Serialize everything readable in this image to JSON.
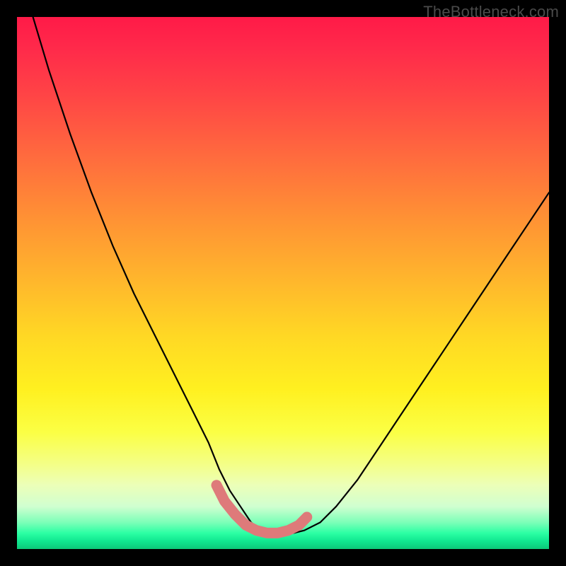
{
  "watermark": "TheBottleneck.com",
  "chart_data": {
    "type": "line",
    "title": "",
    "xlabel": "",
    "ylabel": "",
    "xlim": [
      0,
      100
    ],
    "ylim": [
      0,
      100
    ],
    "series": [
      {
        "name": "black-curve",
        "x": [
          3,
          6,
          10,
          14,
          18,
          22,
          26,
          30,
          33,
          36,
          38,
          40,
          42,
          44,
          46,
          48,
          50,
          52,
          54,
          57,
          60,
          64,
          68,
          72,
          76,
          80,
          84,
          88,
          92,
          96,
          100
        ],
        "values": [
          100,
          90,
          78,
          67,
          57,
          48,
          40,
          32,
          26,
          20,
          15,
          11,
          8,
          5,
          3.5,
          3,
          3,
          3,
          3.5,
          5,
          8,
          13,
          19,
          25,
          31,
          37,
          43,
          49,
          55,
          61,
          67
        ]
      },
      {
        "name": "pink-highlight",
        "x": [
          37.5,
          39,
          41,
          43,
          45,
          47,
          49,
          51,
          53,
          54.5
        ],
        "values": [
          12,
          9,
          6.5,
          4.5,
          3.5,
          3,
          3,
          3.5,
          4.5,
          6
        ]
      }
    ],
    "colors": {
      "curve": "#000000",
      "highlight": "#de7a7a"
    }
  }
}
